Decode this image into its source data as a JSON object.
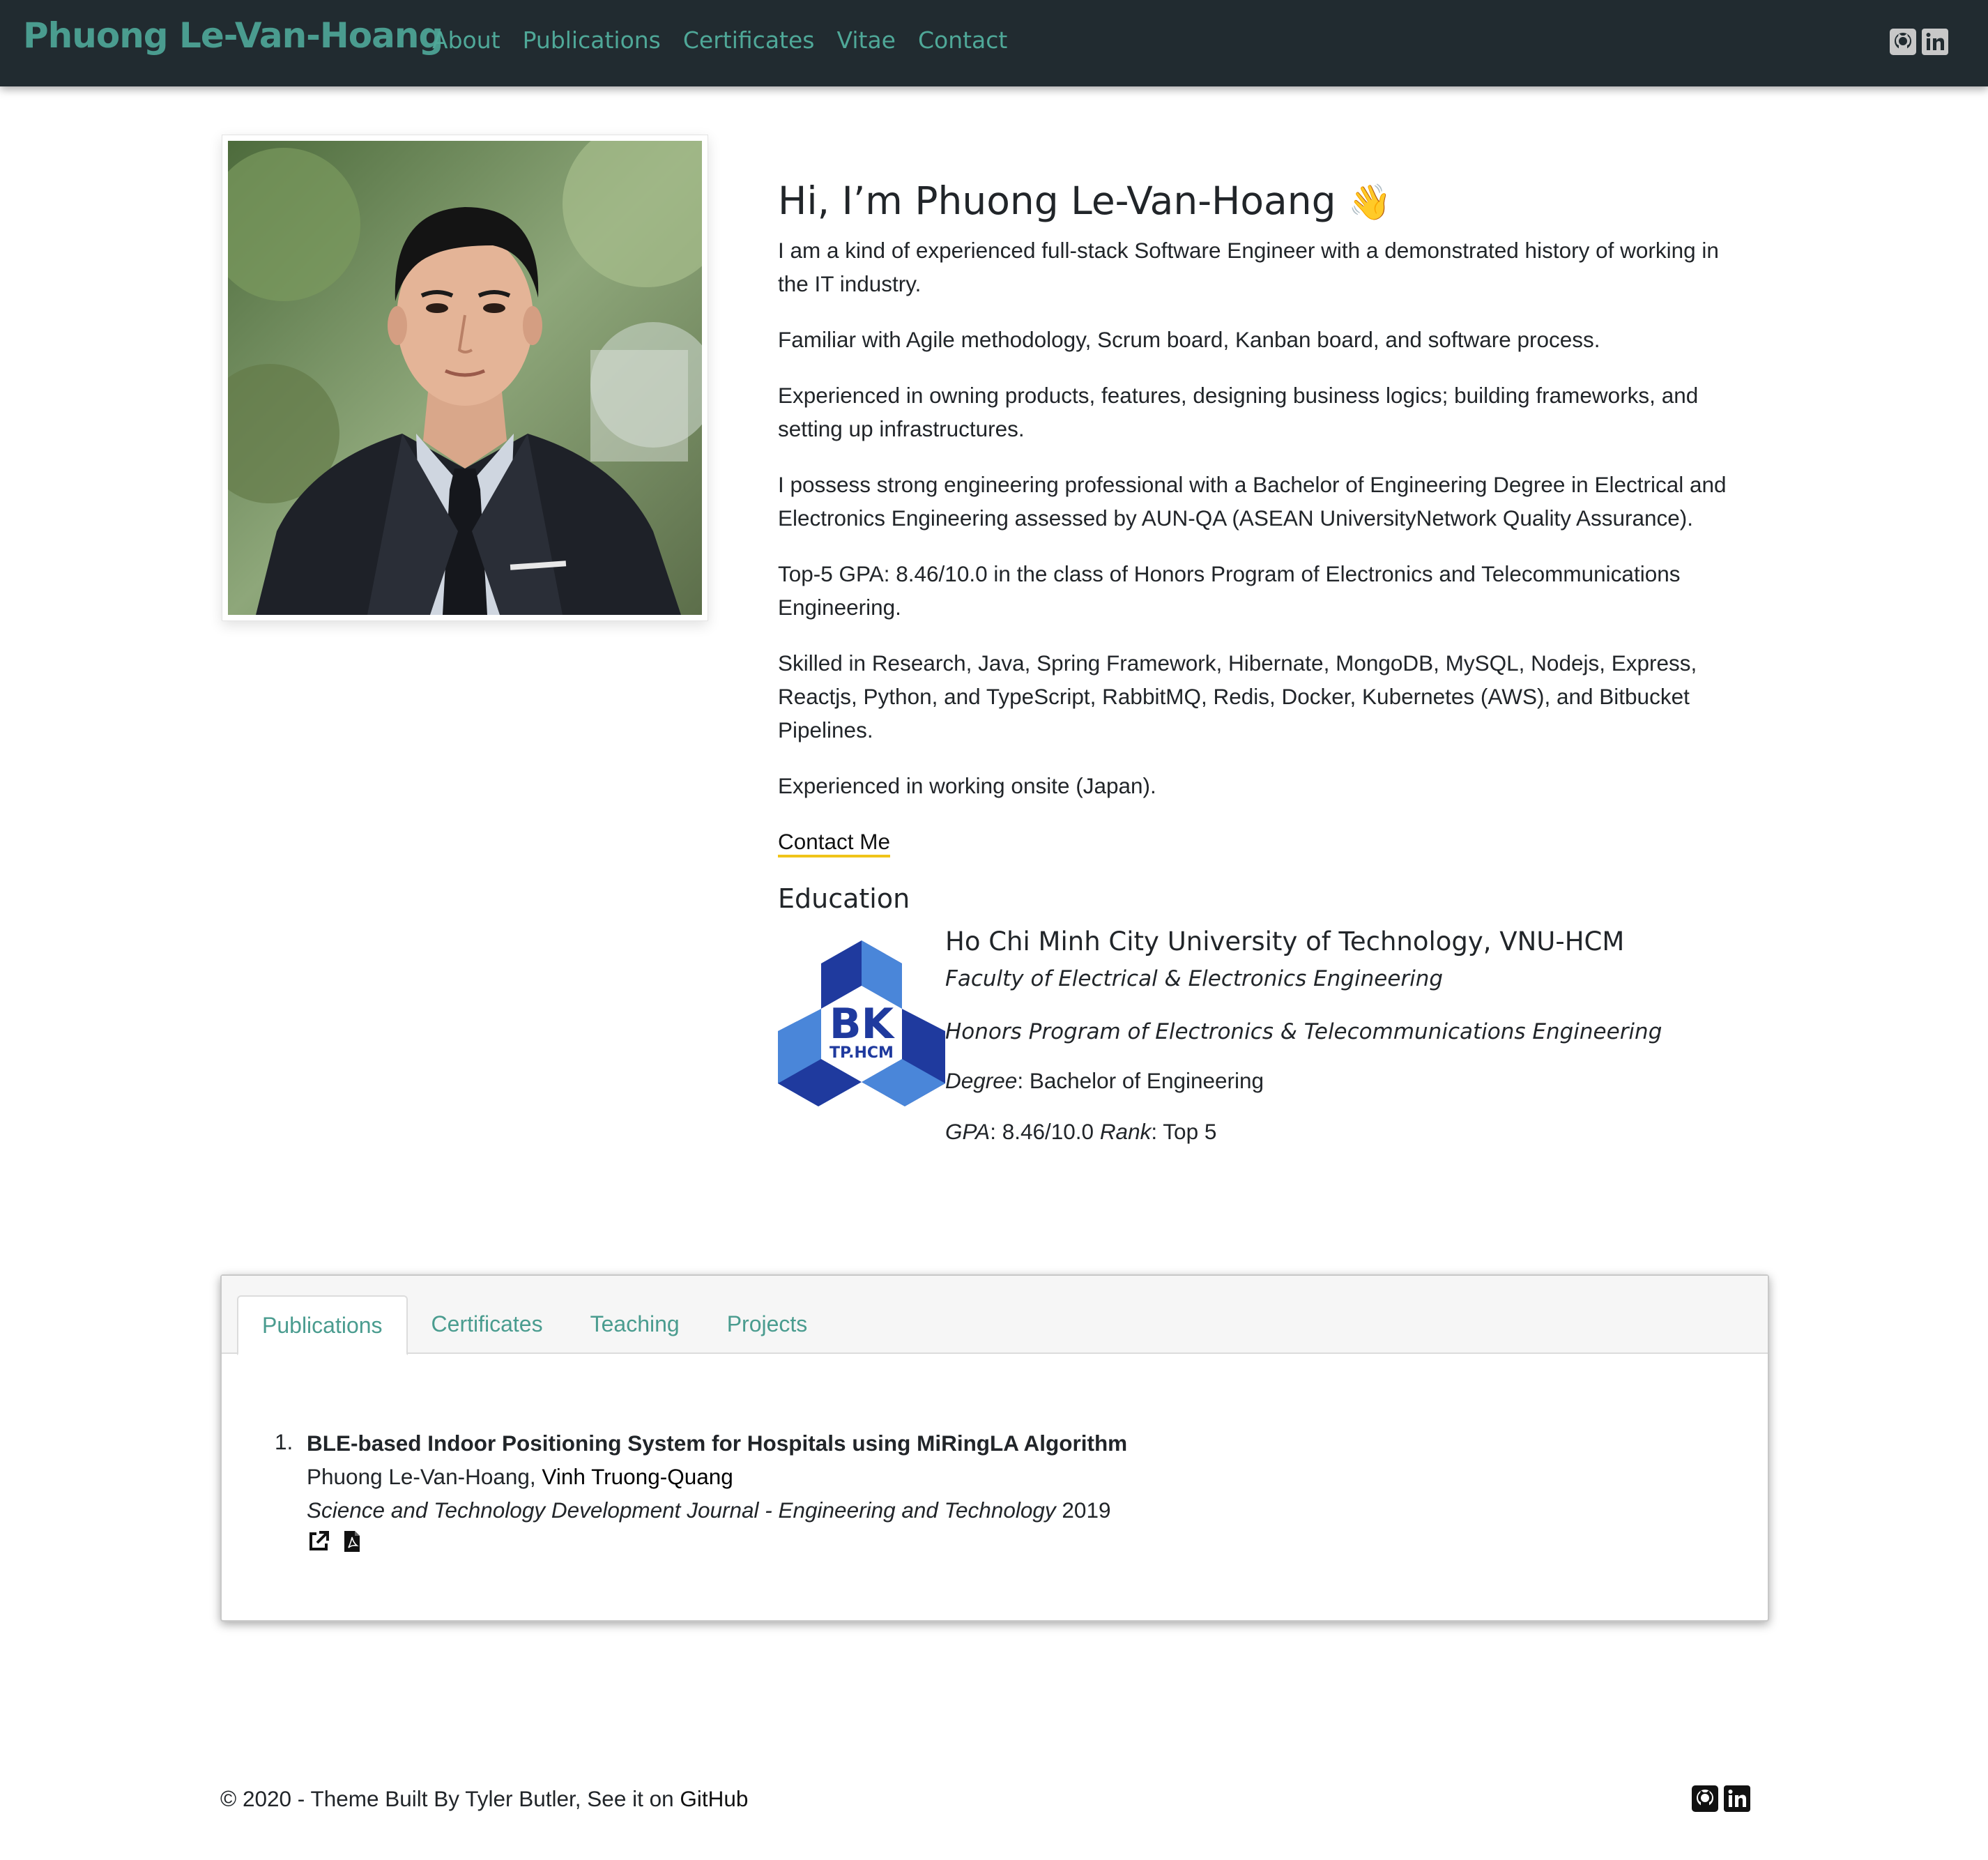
{
  "nav": {
    "brand": "Phuong Le-Van-Hoang",
    "links": [
      "About",
      "Publications",
      "Certificates",
      "Vitae",
      "Contact"
    ],
    "icons": [
      "github-icon",
      "linkedin-icon"
    ],
    "brand_color": "#4a9c8f",
    "bg_color": "#212b30"
  },
  "about": {
    "greeting": "Hi, I’m Phuong Le-Van-Hoang",
    "wave": "👋",
    "paragraphs": [
      "I am a kind of experienced full-stack Software Engineer with a demonstrated history of working in the IT industry.",
      "Familiar with Agile methodology, Scrum board, Kanban board, and software process.",
      "Experienced in owning products, features, designing business logics; building frameworks, and setting up infrastructures.",
      "I possess strong engineering professional with a Bachelor of Engineering Degree in Electrical and Electronics Engineering assessed by AUN-QA (ASEAN UniversityNetwork Quality Assurance).",
      "Top-5 GPA: 8.46/10.0 in the class of Honors Program of Electronics and Telecommunications Engineering.",
      "Skilled in Research, Java, Spring Framework, Hibernate, MongoDB, MySQL, Nodejs, Express, Reactjs, Python, and TypeScript, RabbitMQ, Redis, Docker, Kubernetes (AWS), and Bitbucket Pipelines.",
      "Experienced in working onsite (Japan)."
    ],
    "contact_label": "Contact Me"
  },
  "education": {
    "heading": "Education",
    "logo_text": "BK",
    "logo_subtext": "TP.HCM",
    "university": "Ho Chi Minh City University of Technology, VNU-HCM",
    "faculty": "Faculty of Electrical & Electronics Engineering",
    "program": "Honors Program of Electronics & Telecommunications Engineering",
    "degree_label": "Degree",
    "degree_value": ": Bachelor of Engineering",
    "gpa_label": "GPA",
    "gpa_value": ": 8.46/10.0 ",
    "rank_label": "Rank",
    "rank_value": ": Top 5"
  },
  "tabs": {
    "items": [
      "Publications",
      "Certificates",
      "Teaching",
      "Projects"
    ],
    "active": "Publications"
  },
  "publications": [
    {
      "number": "1.",
      "title": "BLE-based Indoor Positioning System for Hospitals using MiRingLA Algorithm",
      "author_1": "Phuong Le-Van-Hoang, ",
      "author_2": "Vinh Truong-Quang",
      "journal": "Science and Technology Development Journal - Engineering and Technology",
      "year": " 2019",
      "icons": [
        "external-link-icon",
        "pdf-icon"
      ]
    }
  ],
  "footer": {
    "text": "© 2020 - Theme Built By Tyler Butler, See it on ",
    "github_label": "GitHub",
    "icons": [
      "github-icon",
      "linkedin-icon"
    ]
  }
}
